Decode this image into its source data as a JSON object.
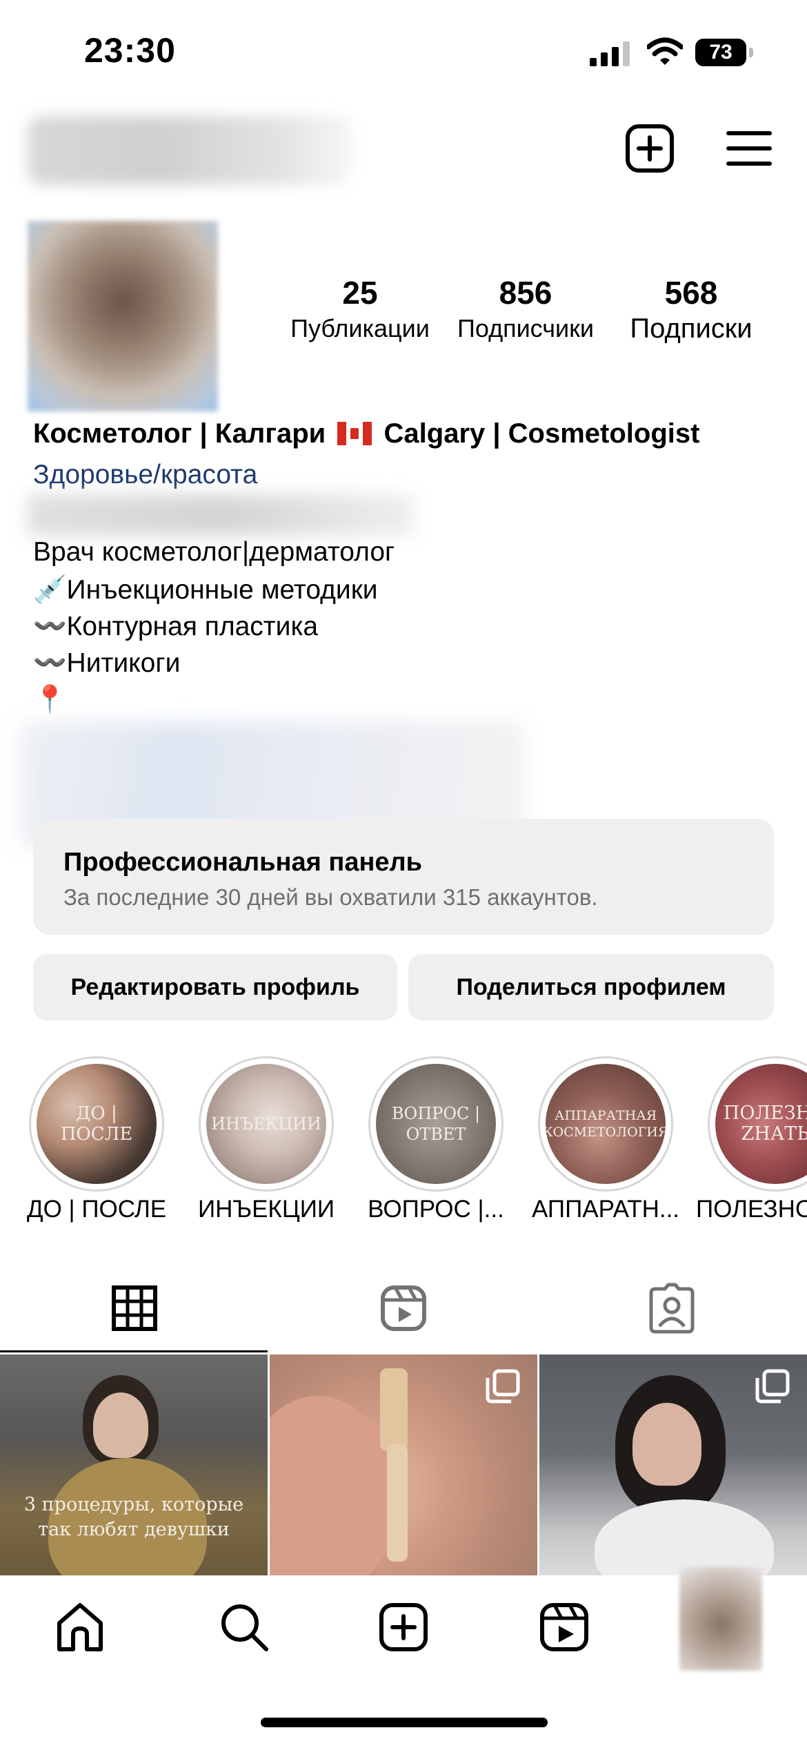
{
  "status_bar": {
    "time": "23:30",
    "battery": "73"
  },
  "profile": {
    "stats": [
      {
        "value": "25",
        "label": "Публикации"
      },
      {
        "value": "856",
        "label": "Подписчики"
      },
      {
        "value": "568",
        "label": "Подписки"
      }
    ],
    "name_part1": "Косметолог | Калгари",
    "name_part2": "Calgary | Cosmetologist",
    "category": "Здоровье/красота",
    "bio": [
      "Врач косметолог|дерматолог",
      "💉Инъекционные методики",
      "〰️Контурная пластика",
      "〰️Нитикоги",
      "📍"
    ]
  },
  "professional_panel": {
    "title": "Профессиональная панель",
    "subtitle": "За последние 30 дней вы охватили 315 аккаунтов."
  },
  "actions": {
    "edit": "Редактировать профиль",
    "share": "Поделиться профилем"
  },
  "highlights": [
    {
      "label": "ДО | ПОСЛЕ",
      "cover_text": "ДО | ПОСЛЕ"
    },
    {
      "label": "ИНЪЕКЦИИ",
      "cover_text": "ИНЪЕКЦИИ"
    },
    {
      "label": "ВОПРОС |...",
      "cover_text": "ВОПРОС | ОТВЕТ"
    },
    {
      "label": "АППАРАТН...",
      "cover_text": "АППАРАТНАЯ КОСМЕТОЛОГИЯ"
    },
    {
      "label": "ПОЛЕЗНО",
      "cover_text": "ПОЛЕЗНО ZНАТЬ"
    }
  ],
  "posts": [
    {
      "overlay_text": "3 процедуры, которые так любят девушки"
    }
  ],
  "icons": {
    "header": [
      "add-post-icon",
      "menu-icon"
    ],
    "tabs": [
      "grid-icon",
      "reels-icon",
      "tagged-icon"
    ],
    "nav": [
      "home-icon",
      "search-icon",
      "create-icon",
      "reels-icon",
      "profile-icon"
    ]
  }
}
